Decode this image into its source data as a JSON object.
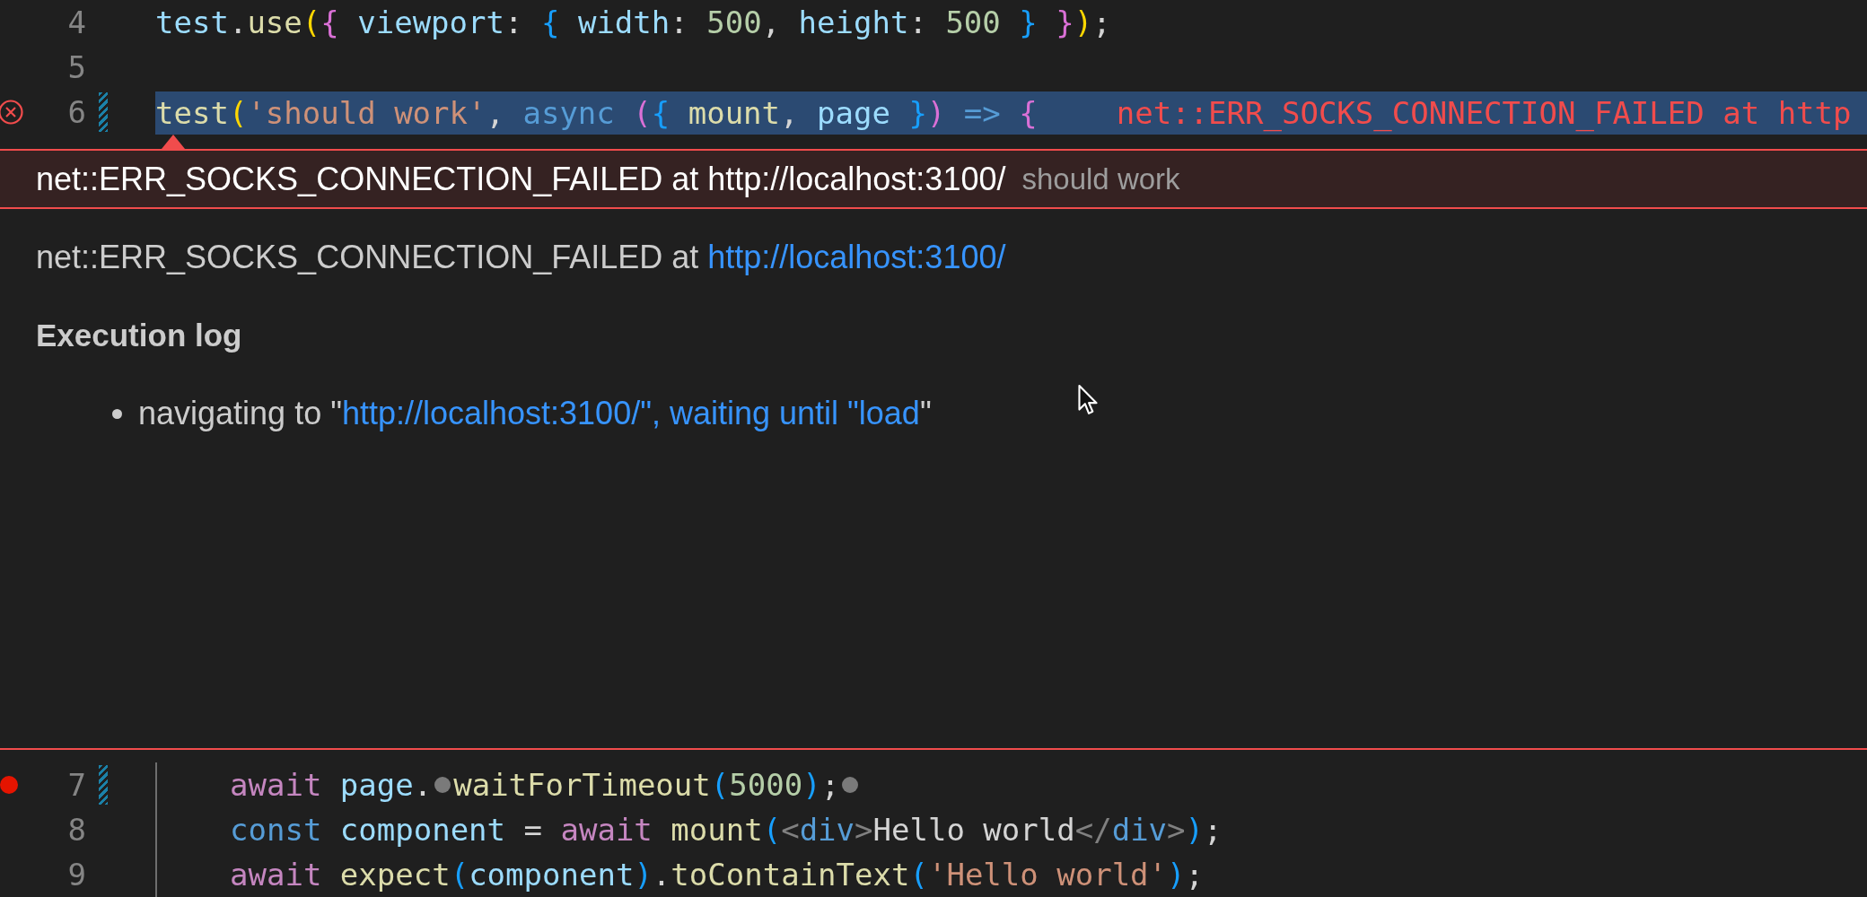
{
  "editor_top": {
    "lines": [
      {
        "number": "4",
        "selected": false,
        "error": false,
        "breakpoint": false,
        "modified": false,
        "tokens": [
          {
            "kind": "var",
            "text": "test"
          },
          {
            "kind": "punc",
            "text": "."
          },
          {
            "kind": "fn",
            "text": "use"
          },
          {
            "kind": "br1",
            "text": "("
          },
          {
            "kind": "br2",
            "text": "{ "
          },
          {
            "kind": "var",
            "text": "viewport"
          },
          {
            "kind": "punc",
            "text": ": "
          },
          {
            "kind": "br3",
            "text": "{ "
          },
          {
            "kind": "var",
            "text": "width"
          },
          {
            "kind": "punc",
            "text": ": "
          },
          {
            "kind": "num",
            "text": "500"
          },
          {
            "kind": "punc",
            "text": ", "
          },
          {
            "kind": "var",
            "text": "height"
          },
          {
            "kind": "punc",
            "text": ": "
          },
          {
            "kind": "num",
            "text": "500 "
          },
          {
            "kind": "br3",
            "text": "} "
          },
          {
            "kind": "br2",
            "text": "}"
          },
          {
            "kind": "br1",
            "text": ")"
          },
          {
            "kind": "punc",
            "text": ";"
          }
        ]
      },
      {
        "number": "5",
        "selected": false,
        "error": false,
        "breakpoint": false,
        "modified": false
      },
      {
        "number": "6",
        "selected": true,
        "error": true,
        "breakpoint": false,
        "modified": true,
        "tokens": [
          {
            "kind": "fn",
            "text": "test"
          },
          {
            "kind": "br1",
            "text": "("
          },
          {
            "kind": "str",
            "text": "'should work'"
          },
          {
            "kind": "punc",
            "text": ", "
          },
          {
            "kind": "store",
            "text": "async "
          },
          {
            "kind": "br2",
            "text": "("
          },
          {
            "kind": "br3",
            "text": "{ "
          },
          {
            "kind": "fn",
            "text": "mount"
          },
          {
            "kind": "punc",
            "text": ", "
          },
          {
            "kind": "var",
            "text": "page "
          },
          {
            "kind": "br3",
            "text": "}"
          },
          {
            "kind": "br2",
            "text": ")"
          },
          {
            "kind": "store",
            "text": " => "
          },
          {
            "kind": "br2",
            "text": "{"
          },
          {
            "kind": "err",
            "text": "net::ERR_SOCKS_CONNECTION_FAILED at http"
          }
        ]
      }
    ]
  },
  "peek": {
    "title": "net::ERR_SOCKS_CONNECTION_FAILED at http://localhost:3100/",
    "subtitle": "should work",
    "message": {
      "text": "net::ERR_SOCKS_CONNECTION_FAILED at ",
      "link": "http://localhost:3100/"
    },
    "section_heading": "Execution log",
    "log": [
      {
        "before": "navigating to \"",
        "link": "http://localhost:3100/\", waiting until \"load",
        "after": "\""
      }
    ]
  },
  "editor_bottom": {
    "lines": [
      {
        "number": "7",
        "selected": false,
        "error": false,
        "breakpoint": true,
        "modified": true,
        "tokens": [
          {
            "kind": "kw",
            "text": "await "
          },
          {
            "kind": "var",
            "text": "page"
          },
          {
            "kind": "punc",
            "text": "."
          },
          {
            "kind": "dot"
          },
          {
            "kind": "fn",
            "text": "waitForTimeout"
          },
          {
            "kind": "br3",
            "text": "("
          },
          {
            "kind": "num",
            "text": "5000"
          },
          {
            "kind": "br3",
            "text": ")"
          },
          {
            "kind": "punc",
            "text": ";"
          },
          {
            "kind": "dot"
          }
        ]
      },
      {
        "number": "8",
        "selected": false,
        "error": false,
        "breakpoint": false,
        "modified": false,
        "tokens": [
          {
            "kind": "store",
            "text": "const "
          },
          {
            "kind": "var",
            "text": "component"
          },
          {
            "kind": "punc",
            "text": " = "
          },
          {
            "kind": "kw",
            "text": "await "
          },
          {
            "kind": "fn",
            "text": "mount"
          },
          {
            "kind": "br3",
            "text": "("
          },
          {
            "kind": "tag",
            "text": "<"
          },
          {
            "kind": "store",
            "text": "div"
          },
          {
            "kind": "tag",
            "text": ">"
          },
          {
            "kind": "punc",
            "text": "Hello world"
          },
          {
            "kind": "tag",
            "text": "</"
          },
          {
            "kind": "store",
            "text": "div"
          },
          {
            "kind": "tag",
            "text": ">"
          },
          {
            "kind": "br3",
            "text": ")"
          },
          {
            "kind": "punc",
            "text": ";"
          }
        ]
      },
      {
        "number": "9",
        "selected": false,
        "error": false,
        "breakpoint": false,
        "modified": false,
        "tokens": [
          {
            "kind": "kw",
            "text": "await "
          },
          {
            "kind": "fn",
            "text": "expect"
          },
          {
            "kind": "br3",
            "text": "("
          },
          {
            "kind": "var",
            "text": "component"
          },
          {
            "kind": "br3",
            "text": ")"
          },
          {
            "kind": "punc",
            "text": "."
          },
          {
            "kind": "fn",
            "text": "toContainText"
          },
          {
            "kind": "br3",
            "text": "("
          },
          {
            "kind": "str",
            "text": "'Hello world'"
          },
          {
            "kind": "br3",
            "text": ")"
          },
          {
            "kind": "punc",
            "text": ";"
          }
        ]
      }
    ]
  }
}
